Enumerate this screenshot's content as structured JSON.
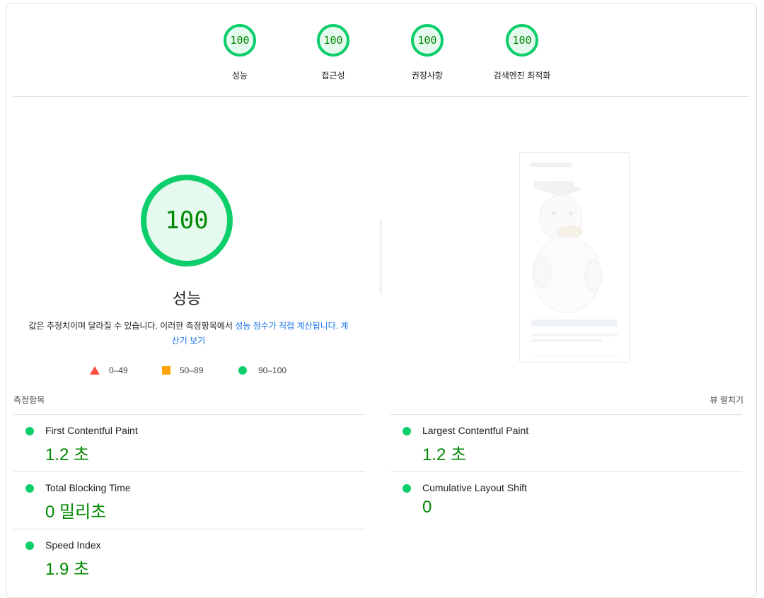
{
  "categories": [
    {
      "score": "100",
      "label": "성능"
    },
    {
      "score": "100",
      "label": "접근성"
    },
    {
      "score": "100",
      "label": "권장사항"
    },
    {
      "score": "100",
      "label": "검색엔진 최적화"
    }
  ],
  "main": {
    "score": "100",
    "title": "성능",
    "description_text": "값은 추정치이며 달라질 수 있습니다. 이러한 측정항목에서 ",
    "description_link": "성능 점수가 직접 계산됩니다.",
    "calculator_link": "계산기 보기"
  },
  "legend": {
    "fail": "0–49",
    "average": "50–89",
    "pass": "90–100"
  },
  "colors": {
    "pass": "#0cce6b",
    "average": "#ffa400",
    "fail": "#ff4e42",
    "pass_text": "#008800",
    "link": "#1a73e8"
  },
  "metrics": {
    "header": "측정항목",
    "expand_label": "뷰 펼치기",
    "items": [
      {
        "title": "First Contentful Paint",
        "value": "1.2 초"
      },
      {
        "title": "Largest Contentful Paint",
        "value": "1.2 초"
      },
      {
        "title": "Total Blocking Time",
        "value": "0 밀리초"
      },
      {
        "title": "Cumulative Layout Shift",
        "value": "0"
      },
      {
        "title": "Speed Index",
        "value": "1.9 초"
      }
    ]
  }
}
